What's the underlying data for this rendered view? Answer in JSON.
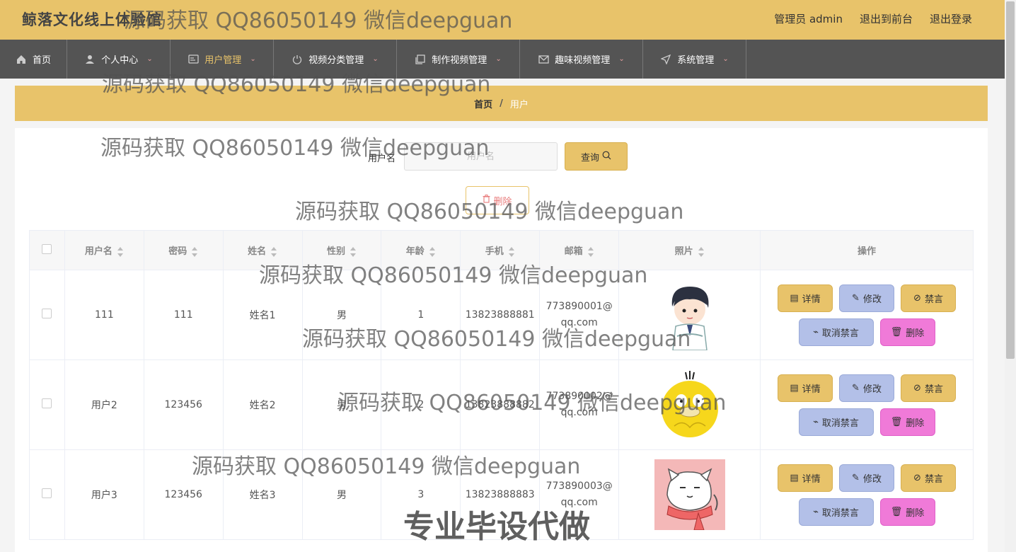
{
  "site": {
    "title": "鲸落文化线上体验馆"
  },
  "header": {
    "admin_label": "管理员 admin",
    "front_label": "退出到前台",
    "logout_label": "退出登录"
  },
  "nav": {
    "items": [
      {
        "label": "首页",
        "icon": "home-icon"
      },
      {
        "label": "个人中心",
        "icon": "user-icon"
      },
      {
        "label": "用户管理",
        "icon": "card-icon"
      },
      {
        "label": "视频分类管理",
        "icon": "power-icon"
      },
      {
        "label": "制作视频管理",
        "icon": "copy-icon"
      },
      {
        "label": "趣味视频管理",
        "icon": "mail-icon"
      },
      {
        "label": "系统管理",
        "icon": "send-icon"
      }
    ],
    "active_color": "#e8c36a"
  },
  "breadcrumb": {
    "home": "首页",
    "sep": "/",
    "current": "用户"
  },
  "search": {
    "label": "用户名",
    "placeholder": "用户名",
    "value": "",
    "button_label": "查询"
  },
  "toolbar": {
    "delete_label": "删除"
  },
  "table": {
    "headers": [
      "用户名",
      "密码",
      "姓名",
      "性别",
      "年龄",
      "手机",
      "邮箱",
      "照片",
      "操作"
    ],
    "rows": [
      {
        "username": "111",
        "password": "111",
        "name": "姓名1",
        "gender": "男",
        "age": "1",
        "phone": "13823888881",
        "email": "773890001@qq.com",
        "photo": "boy-avatar"
      },
      {
        "username": "用户2",
        "password": "123456",
        "name": "姓名2",
        "gender": "男",
        "age": "2",
        "phone": "13823888882",
        "email": "773890002@qq.com",
        "photo": "duck-avatar"
      },
      {
        "username": "用户3",
        "password": "123456",
        "name": "姓名3",
        "gender": "男",
        "age": "3",
        "phone": "13823888883",
        "email": "773890003@qq.com",
        "photo": "cat-avatar"
      }
    ],
    "actions": {
      "detail": "详情",
      "edit": "修改",
      "ban": "禁言",
      "unban": "取消禁言",
      "delete": "删除"
    }
  },
  "watermarks": {
    "text": "源码获取 QQ86050149 微信deepguan",
    "big": "专业毕设代做"
  },
  "colors": {
    "header": "#e8c36a",
    "nav": "#545454",
    "unban": "#b3c0e8",
    "delete": "#f07ad8"
  }
}
